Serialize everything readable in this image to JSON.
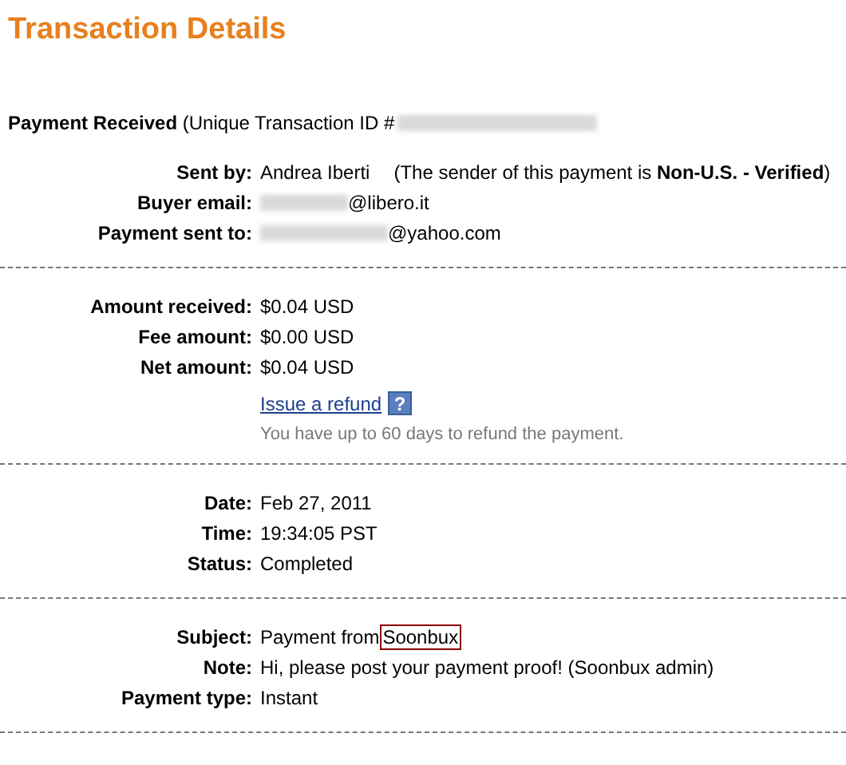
{
  "title": "Transaction Details",
  "header": "**Payment Received** (Unique Transaction ID #",
  "sections": [
    {
      "rows": [
        {
          "kind": "text",
          "label": "Sent by:",
          "value": "Andrea Iberti",
          "extra": "(The sender of this payment is **Non-U.S. - Verified**)"
        },
        {
          "kind": "redacted",
          "label": "Buyer email:",
          "value": "@libero.it"
        },
        {
          "kind": "redacted",
          "label": "Payment sent to:",
          "value": "@yahoo.com"
        }
      ]
    },
    {
      "rows": [
        {
          "kind": "text",
          "label": "Amount received:",
          "value": "$0.04 USD"
        },
        {
          "kind": "text",
          "label": "Fee amount:",
          "value": "$0.00 USD"
        },
        {
          "kind": "text",
          "label": "Net amount:",
          "value": "$0.04 USD"
        },
        {
          "kind": "refund",
          "link": "Issue a refund",
          "help": "?",
          "note": "You have up to 60 days to refund the payment."
        }
      ]
    },
    {
      "rows": [
        {
          "kind": "text",
          "label": "Date:",
          "value": "Feb 27, 2011"
        },
        {
          "kind": "text",
          "label": "Time:",
          "value": "19:34:05 PST"
        },
        {
          "kind": "text",
          "label": "Status:",
          "value": "Completed"
        }
      ]
    },
    {
      "rows": [
        {
          "kind": "highlight",
          "label": "Subject:",
          "value": "Payment from ",
          "highlight": "Soonbux"
        },
        {
          "kind": "text",
          "label": "Note:",
          "value": "Hi, please post your payment proof! (Soonbux admin)"
        },
        {
          "kind": "text",
          "label": "Payment type:",
          "value": "Instant"
        }
      ]
    }
  ]
}
